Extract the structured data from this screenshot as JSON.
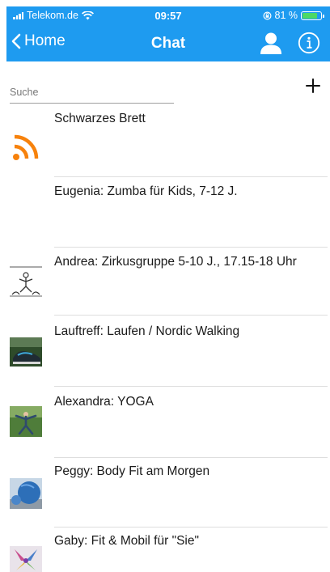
{
  "status_bar": {
    "carrier": "Telekom.de",
    "time": "09:57",
    "battery": "81 %",
    "battery_level": 0.81
  },
  "nav": {
    "back_label": "Home",
    "title": "Chat",
    "user_icon": "user-icon",
    "info_icon": "info-icon"
  },
  "search": {
    "placeholder": "Suche"
  },
  "add_icon": "plus-icon",
  "colors": {
    "header": "#1e9bf0",
    "rss": "#f7820c"
  },
  "chats": [
    {
      "label": "Schwarzes Brett",
      "icon": "rss-icon"
    },
    {
      "label": "Eugenia: Zumba für Kids, 7-12 J.",
      "icon": ""
    },
    {
      "label": "Andrea: Zirkusgruppe 5-10 J., 17.15-18 Uhr",
      "icon": "acrobat-image"
    },
    {
      "label": "Lauftreff: Laufen / Nordic Walking",
      "icon": "running-shoe-image"
    },
    {
      "label": "Alexandra: YOGA",
      "icon": "yoga-pose-image"
    },
    {
      "label": "Peggy: Body Fit am Morgen",
      "icon": "gym-ball-image"
    },
    {
      "label": "Gaby: Fit & Mobil für \"Sie\"",
      "icon": "flower-image"
    }
  ]
}
